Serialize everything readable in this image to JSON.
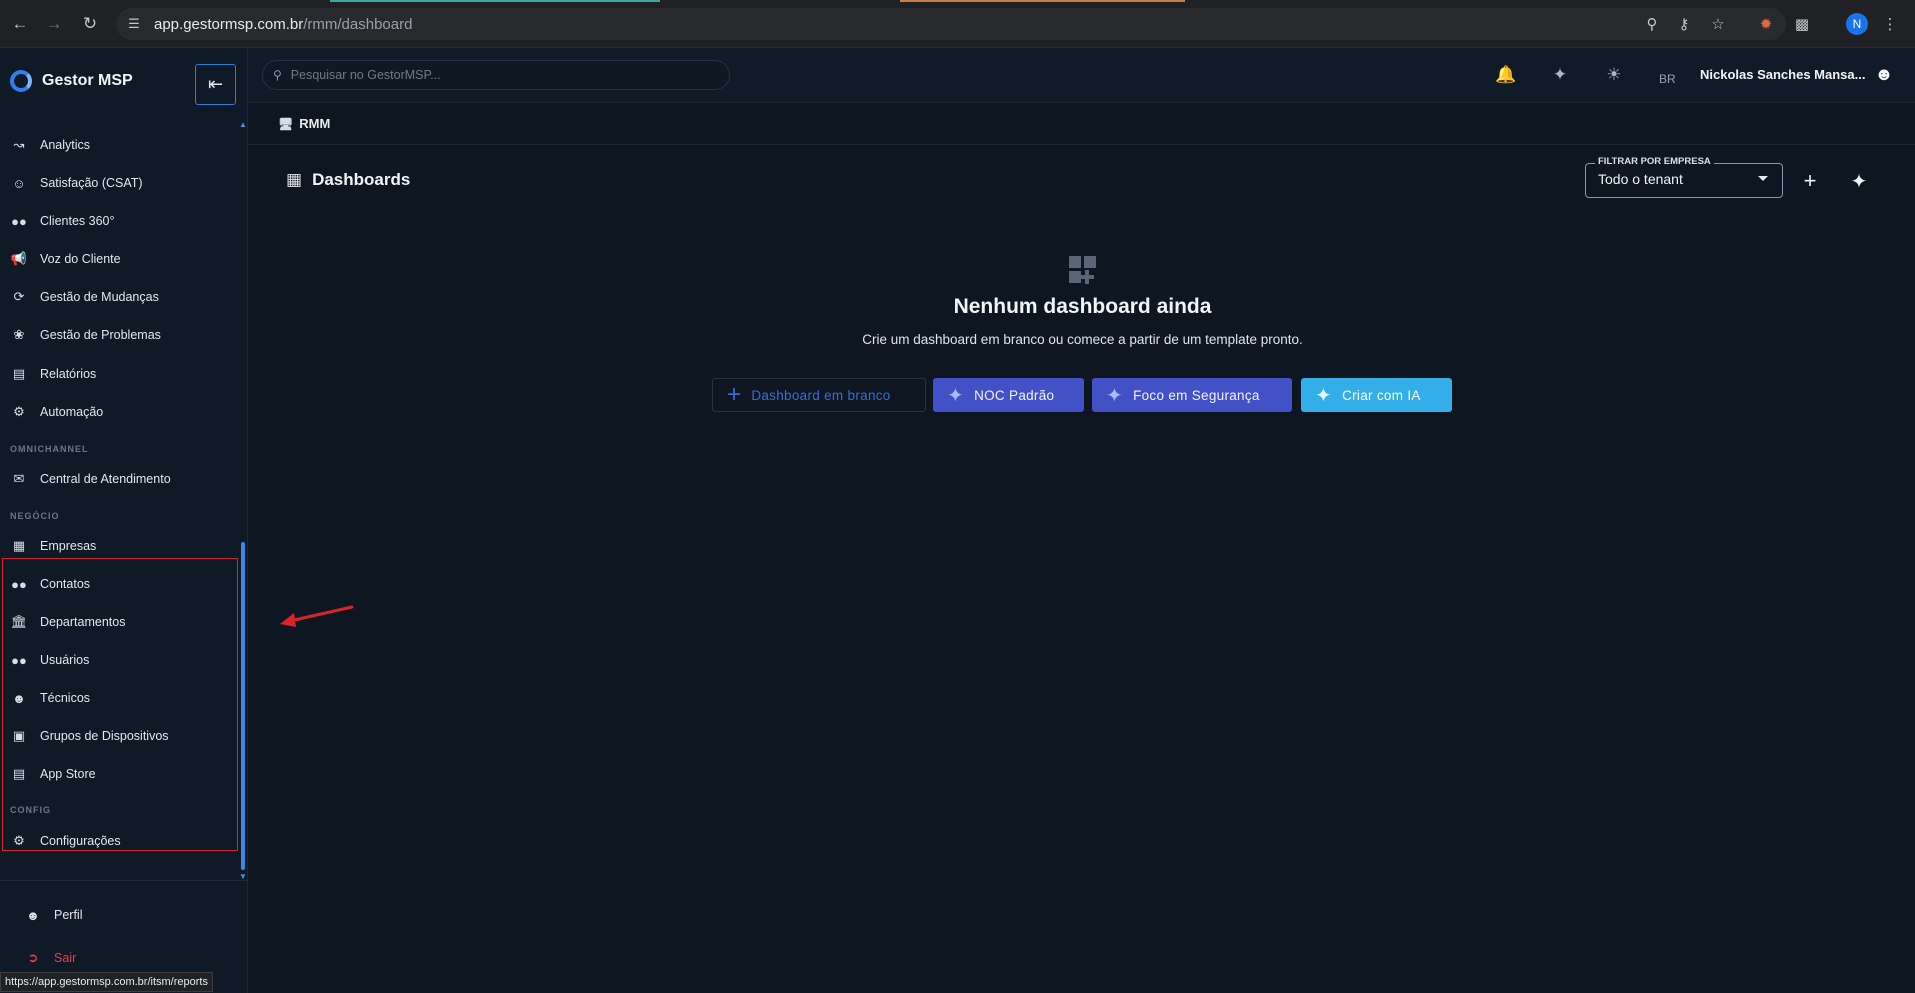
{
  "browser": {
    "url_host": "app.gestormsp.com.br",
    "url_path": "/rmm/dashboard",
    "profile_initial": "N",
    "status_url": "https://app.gestormsp.com.br/itsm/reports"
  },
  "brand": {
    "name": "Gestor MSP"
  },
  "sidebar": {
    "items_top": [
      {
        "label": "Analytics",
        "icon": "chart-line-icon"
      },
      {
        "label": "Satisfação (CSAT)",
        "icon": "smiley-icon"
      },
      {
        "label": "Clientes 360°",
        "icon": "group-icon"
      },
      {
        "label": "Voz do Cliente",
        "icon": "megaphone-icon"
      },
      {
        "label": "Gestão de Mudanças",
        "icon": "change-icon"
      },
      {
        "label": "Gestão de Problemas",
        "icon": "bug-icon"
      },
      {
        "label": "Relatórios",
        "icon": "report-icon"
      },
      {
        "label": "Automação",
        "icon": "robot-icon"
      }
    ],
    "section_omnichannel": "OMNICHANNEL",
    "omnichannel_items": [
      {
        "label": "Central de Atendimento",
        "icon": "chat-icon"
      }
    ],
    "section_negocio": "NEGÓCIO",
    "negocio_items": [
      {
        "label": "Empresas",
        "icon": "building-icon"
      },
      {
        "label": "Contatos",
        "icon": "contacts-icon"
      },
      {
        "label": "Departamentos",
        "icon": "bank-icon"
      },
      {
        "label": "Usuários",
        "icon": "users-icon"
      },
      {
        "label": "Técnicos",
        "icon": "technician-icon"
      },
      {
        "label": "Grupos de Dispositivos",
        "icon": "device-group-icon"
      },
      {
        "label": "App Store",
        "icon": "store-icon"
      }
    ],
    "section_config": "CONFIG",
    "config_items": [
      {
        "label": "Configurações",
        "icon": "gear-icon"
      }
    ],
    "footer": {
      "profile_label": "Perfil",
      "logout_label": "Sair"
    }
  },
  "topbar": {
    "search_placeholder": "Pesquisar no GestorMSP...",
    "lang": "BR",
    "username": "Nickolas Sanches Mansa..."
  },
  "breadcrumb": {
    "label": "RMM"
  },
  "page": {
    "title": "Dashboards",
    "filter_label": "FILTRAR POR EMPRESA",
    "filter_value": "Todo o tenant"
  },
  "empty_state": {
    "title": "Nenhum dashboard ainda",
    "subtitle": "Crie um dashboard em branco ou comece a partir de um template pronto.",
    "buttons": {
      "blank": "Dashboard em branco",
      "noc": "NOC Padrão",
      "security": "Foco em Segurança",
      "ai": "Criar com IA"
    }
  },
  "colors": {
    "accent": "#3d88e0",
    "primary_button": "#4351c6",
    "ai_button": "#33aee8",
    "highlight": "#d0262f",
    "logout": "#e2434b"
  }
}
